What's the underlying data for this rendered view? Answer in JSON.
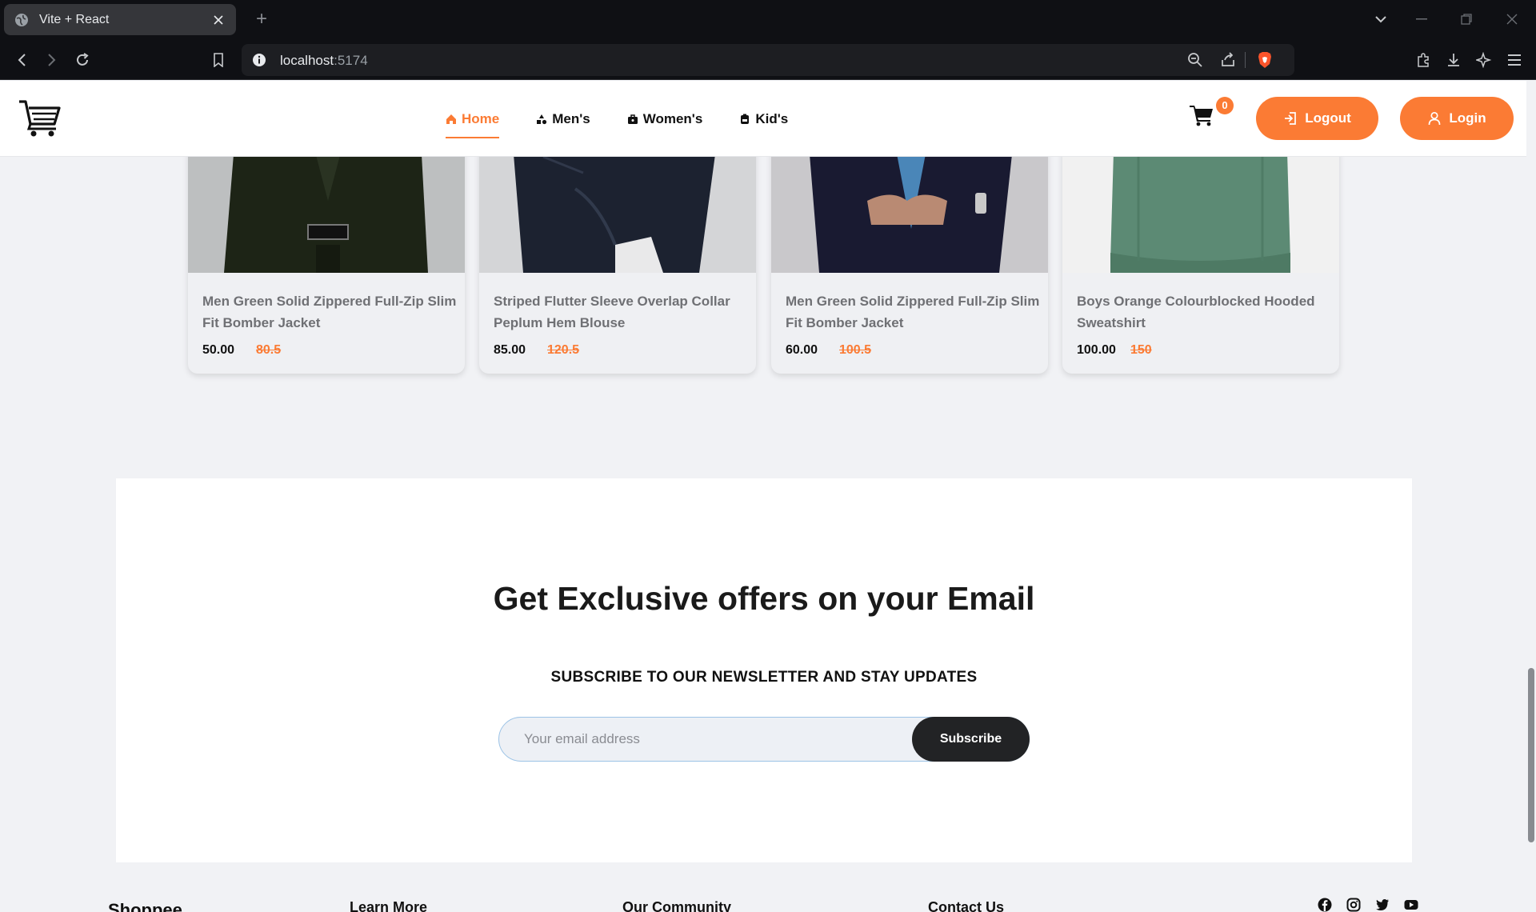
{
  "browser": {
    "tab_title": "Vite + React",
    "url_host": "localhost",
    "url_port": ":5174"
  },
  "header": {
    "nav": [
      {
        "label": "Home",
        "icon": "home-icon"
      },
      {
        "label": "Men's",
        "icon": "shapes-icon"
      },
      {
        "label": "Women's",
        "icon": "briefcase-icon"
      },
      {
        "label": "Kid's",
        "icon": "backpack-icon"
      }
    ],
    "active_nav": "Home",
    "cart_count": "0",
    "logout_label": "Logout",
    "login_label": "Login",
    "accent_color": "#fb7b34"
  },
  "products": [
    {
      "name": "Men Green Solid Zippered Full-Zip Slim Fit Bomber Jacket",
      "price": "50.00",
      "old_price": "80.5"
    },
    {
      "name": "Striped Flutter Sleeve Overlap Collar Peplum Hem Blouse",
      "price": "85.00",
      "old_price": "120.5"
    },
    {
      "name": "Men Green Solid Zippered Full-Zip Slim Fit Bomber Jacket",
      "price": "60.00",
      "old_price": "100.5"
    },
    {
      "name": "Boys Orange Colourblocked Hooded Sweatshirt",
      "price": "100.00",
      "old_price": "150"
    }
  ],
  "newsletter": {
    "title": "Get Exclusive offers on your Email",
    "subtitle": "SUBSCRIBE TO OUR NEWSLETTER AND STAY UPDATES",
    "placeholder": "Your email address",
    "button": "Subscribe"
  },
  "footer": {
    "brand": "Shoppee",
    "columns": [
      "Learn More",
      "Our Community",
      "Contact Us"
    ],
    "social": [
      "facebook-icon",
      "instagram-icon",
      "twitter-icon",
      "youtube-icon"
    ]
  }
}
